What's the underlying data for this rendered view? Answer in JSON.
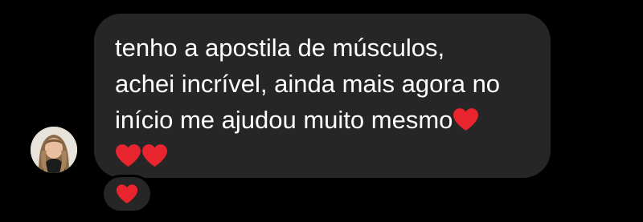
{
  "message": {
    "line1": "tenho a apostila de músculos,",
    "line2": "achei incrível, ainda mais agora no",
    "line3": "início me ajudou muito mesmo",
    "emoji": "red-heart-icon",
    "emoji_char": "❤️"
  },
  "reaction": {
    "emoji": "red-heart-icon"
  },
  "colors": {
    "background": "#000000",
    "bubble": "#262626",
    "text": "#ffffff",
    "heart": "#e8242f"
  }
}
